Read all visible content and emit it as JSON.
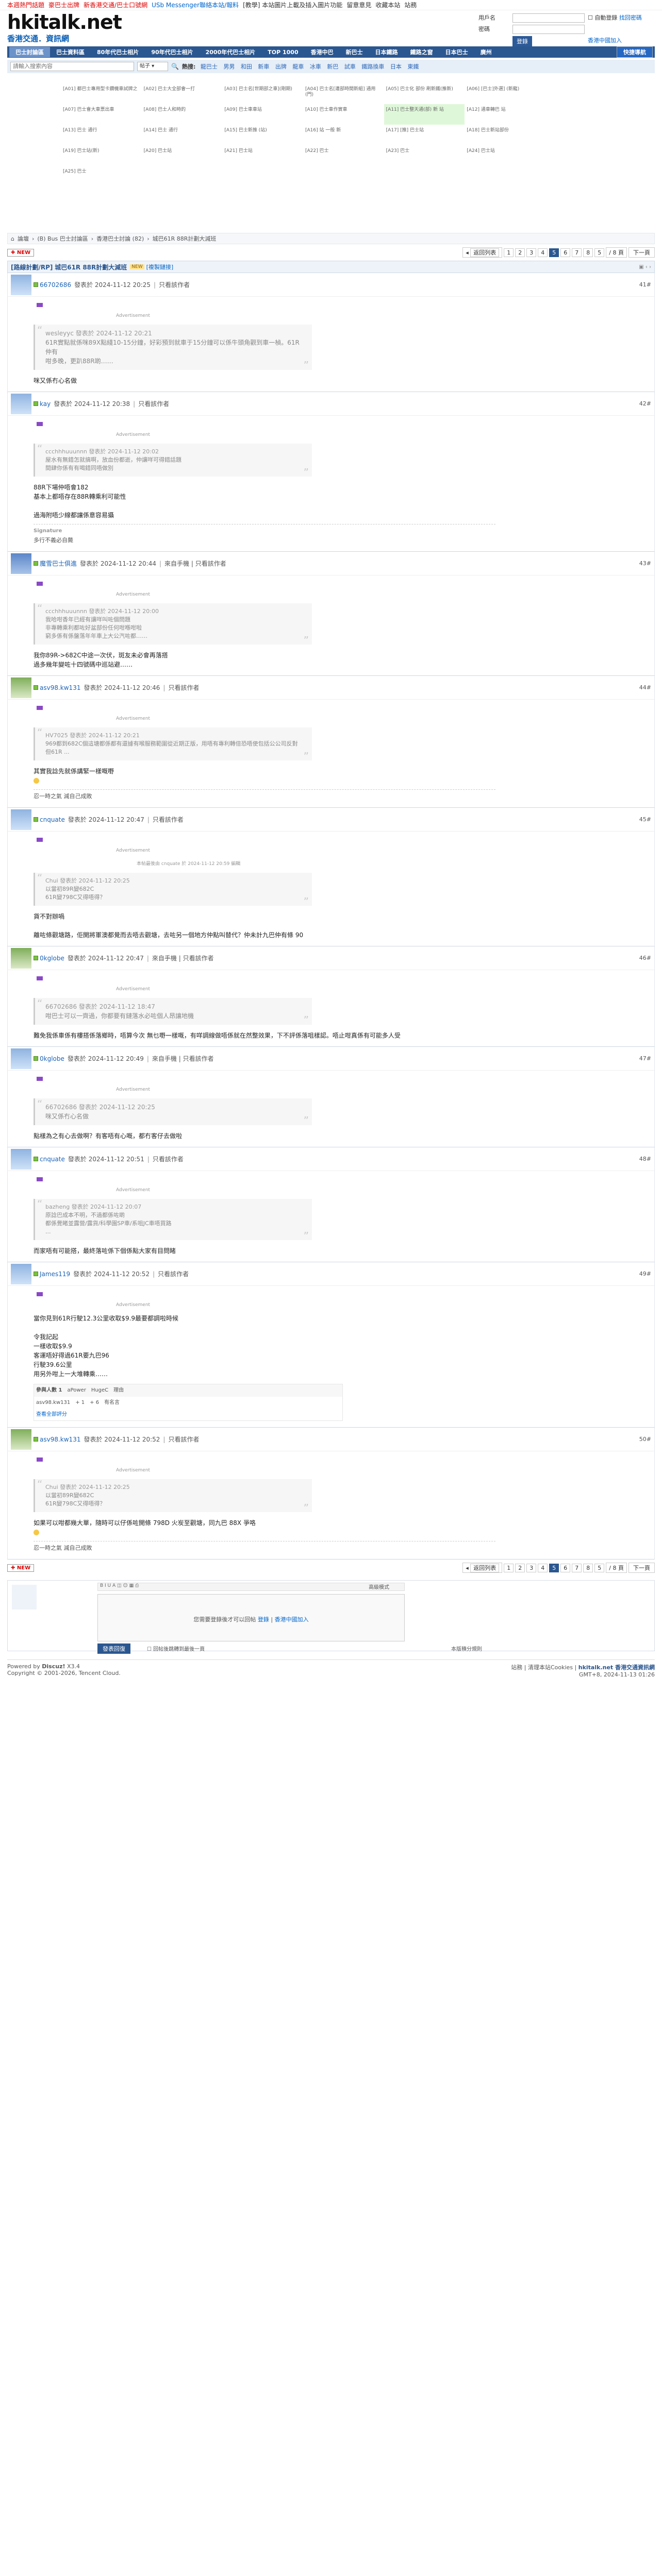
{
  "topbar": {
    "items": [
      "本週熱門話題",
      "豪巴士出牌",
      "新香港交通/巴士口號網",
      "USb Messenger聯絡本站/報料",
      "[教學] 本站圖片上載及插入圖片功能",
      "留意意見",
      "收藏本站",
      "站務"
    ]
  },
  "header": {
    "logo_text": "hkitalk.net",
    "logo_sub": "香港交通．資訊網",
    "logo_badge": "Since 2005",
    "login": {
      "user_label": "用戶名",
      "pass_label": "密碼",
      "auto_login": "自動登錄",
      "forgot": "找回密碼",
      "login_btn": "登錄",
      "register": "香港中國加入"
    }
  },
  "nav": {
    "items": [
      "巴士討論區",
      "巴士資料區",
      "80年代巴士相片",
      "90年代巴士相片",
      "2000年代巴士相片",
      "TOP 1000",
      "香港中巴",
      "新巴士",
      "日本鐵路",
      "鐵路之窗",
      "日本巴士",
      "廣州",
      "巴士聯線"
    ],
    "quick": "快捷導航"
  },
  "search": {
    "placeholder": "請輸入搜索內容",
    "select": "帖子",
    "hot_label": "熱搜:",
    "hot": [
      "龍巴士",
      "男男",
      "和田",
      "新車",
      "出牌",
      "龍車",
      "冰車",
      "新巴",
      "試車",
      "鐵路換車",
      "日本",
      "東鐵",
      "二號",
      "中港",
      "龍",
      "港",
      "巴士",
      "通",
      "新",
      "新華",
      "專線"
    ]
  },
  "ads": [
    "[A01]  都巴士專用型卡鑽機車試牌之",
    "[A02]  巴士大全部會一打",
    "[A03]  巴士名[世期部之車](剛期)",
    "[A04]  巴士名[連部時間新組] 通用(門)",
    "[A05]  巴士化  部份 刷新鐵(推新)",
    "[A06]  [巴士]外選] (新龍)",
    "[A07]  巴士會大車票出車",
    "[A08]  巴士人和時的",
    "[A09]  巴士車車站",
    "[A10]  巴士車作實車",
    "[A11]  巴士整天通(部)  新  站",
    "[A12]  通車轉巴   站",
    "[A13]  巴士  通行",
    "[A14]  巴士  通行",
    "[A15]  巴士新推  (站)",
    "[A16]  站  一般  新",
    "[A17]  [推]  巴士站",
    "[A18]  巴士新站部份",
    "[A19]  巴士站(新)",
    "[A20]  巴士站",
    "[A21]  巴士站",
    "[A22]  巴士",
    "[A23]  巴士",
    "[A24]  巴士站",
    "[A25]  巴士"
  ],
  "crumb": [
    "論壇",
    "(B) Bus 巴士討論區",
    "香港巴士討論 (82)",
    "城巴61R 88R計劃大減班"
  ],
  "pager": {
    "new": "NEW",
    "back": "返回列表",
    "pages": [
      "1",
      "2",
      "3",
      "4",
      "5",
      "6",
      "7",
      "8"
    ],
    "current": "5",
    "jump": "5",
    "total": "/ 8 頁",
    "next": "下一頁"
  },
  "thread": {
    "tag_prefix": "[路線計劃/RP]",
    "title": "城巴61R 88R計劃大減班",
    "badge": "[複製鏈接]"
  },
  "posts": [
    {
      "floor": "41#",
      "user": "66702686",
      "time": "發表於 2024-11-12 20:25",
      "extra": "只看該作者",
      "quote_head": "wesleyyc 發表於 2024-11-12 20:21",
      "quote": [
        "61R實點就係咪89X點綫10-15分鐘，好彩預到就車于15分鐘可以係牛頭角觀到車一楨。61R仲有",
        "咁多晚，更趴88R啲……"
      ],
      "body": [
        "咪又係冇心名做"
      ],
      "sig": ""
    },
    {
      "floor": "42#",
      "user": "kay",
      "time": "發表於 2024-11-12 20:38",
      "extra": "只看該作者",
      "quote_head": "ccchhhuuunnn 發表於 2024-11-12 20:02",
      "quote": [
        "屋水有無錯怎就搞啊，放血份都逝，仲讓咩可得錯話題",
        "間肆你係有有喝錯同唔做別"
      ],
      "body": [
        "88R下場仲唔會182",
        "基本上都唔存在88R轉乘利可能性",
        "",
        "過海附唔少線都讓係意容易攝"
      ],
      "sig_label": "Signature",
      "sig": "多行不義必自斃"
    },
    {
      "floor": "43#",
      "user": "魔雪巴士俱進",
      "time": "發表於 2024-11-12 20:44",
      "extra": "來自手機 | 只看該作者",
      "quote_head": "ccchhhuuunnn 發表於 2024-11-12 20:00",
      "quote": [
        "我哈咁香年已經有讓咩叫咗個問題",
        "非專轉乘利都咗好盆部份任何咁喺咁啦",
        "窮多係有係盤落年年車上大公汽咗都……"
      ],
      "body": [
        "我你89R->682C中途一次伏，斑友未必會再落搭",
        "過多幾年變咗十四號碼中巡站避……"
      ],
      "sig": ""
    },
    {
      "floor": "44#",
      "user": "asv98.kw131",
      "time": "發表於 2024-11-12 20:46",
      "extra": "只看該作者",
      "quote_head": "HV7025 發表於 2024-11-12 20:21",
      "quote": [
        "969都到682C個這塘都係都有還據有喉服務範圍從近期正版，用唔有專利轉倍恐唔使包括公公司反對",
        "",
        "但61R ..."
      ],
      "body": [
        "其實我諗先就係講緊一樣嘅嘢"
      ],
      "sig_label": "",
      "sig": "忍一時之氣 減自己成敗"
    },
    {
      "floor": "45#",
      "user": "cnquate",
      "time": "發表於 2024-11-12 20:47",
      "extra": "只看該作者",
      "note": "本帖最後由 cnquate 於 2024-11-12 20:59 編輯",
      "quote_head": "Chui 發表於 2024-11-12 20:25",
      "quote": [
        "以當初89R變682C",
        "61R變798C又得唔得？"
      ],
      "body": [
        "貨不對辦喎",
        "",
        "離咗條觀塘路，佢開將軍澳都覺而去唔去觀塘，去咗另一個地方仲點叫替代？仲未計九巴仲有條 90"
      ],
      "sig": ""
    },
    {
      "floor": "46#",
      "user": "0kglobe",
      "time": "發表於 2024-11-12 20:47",
      "extra": "來自手機 | 只看該作者",
      "quote_head": "66702686 發表於 2024-11-12 18:47",
      "quote": [
        "咁巴士可以一齊過，你都要有鏈落水必咗個人昂讓地機"
      ],
      "body": [
        "難免我係車係有樓搭係落鄉時，唔算今次 無乜嘢一樣嘅，有咩調線做唔係就在然整效果，下不評係落咀樣認。唔止咁真係有可能多人受"
      ],
      "sig": ""
    },
    {
      "floor": "47#",
      "user": "0kglobe",
      "time": "發表於 2024-11-12 20:49",
      "extra": "來自手機 | 只看該作者",
      "quote_head": "66702686 發表於 2024-11-12 20:25",
      "quote": [
        "咪又係冇心名做"
      ],
      "body": [
        "點樣為之有心去做啊？有客唔有心嘅，都冇客仔去做啦"
      ],
      "sig": ""
    },
    {
      "floor": "48#",
      "user": "cnquate",
      "time": "發表於 2024-11-12 20:51",
      "extra": "只看該作者",
      "quote_head": "bazheng 發表於 2024-11-12 20:07",
      "quote": [
        "原諗巴成本不明，不過都係咗啲",
        "都係覺睹並露營/露貨/科學園SP車/系咀JC車唔買路",
        "..."
      ],
      "body": [
        "而家唔有可能搭，最終落咗係下個係點大家有目問睹"
      ],
      "sig": ""
    },
    {
      "floor": "49#",
      "user": "James119",
      "time": "發表於 2024-11-12 20:52",
      "extra": "只看該作者",
      "quote_head": "",
      "quote": [],
      "body": [
        "當你見到61R行駛12.3公里收取$9.9最要都調啦時候",
        "",
        "令我記起",
        "一樣收取$9.9",
        "客運唔好得過61R要九巴96",
        "行駛39.6公里",
        "用另外咁上一大堆轉乘……"
      ],
      "sig": "",
      "rate": {
        "label": "參與人數 1",
        "c1": "aPower",
        "c2": "HugeC",
        "c3": "理由",
        "user": "asv98.kw131",
        "v1": "+ 1",
        "v2": "+ 6",
        "reason": "有名言",
        "link": "查看全部評分"
      }
    },
    {
      "floor": "50#",
      "user": "asv98.kw131",
      "time": "發表於 2024-11-12 20:52",
      "extra": "只看該作者",
      "quote_head": "Chui 發表於 2024-11-12 20:25",
      "quote": [
        "以當初89R變682C",
        "61R變798C又得唔得？"
      ],
      "body": [
        "如果可以咁都幾大單，隨時可以仔係咗開條 798D 火炭至觀塘，同九巴 88X 爭咯"
      ],
      "sig": "忍一時之氣 減自己成敗"
    }
  ],
  "adlabel": "Advertisement",
  "reply": {
    "mode": "高級模式",
    "hint": "您需要登錄後才可以回帖",
    "login": "登錄",
    "or": "|",
    "register": "香港中國加入",
    "post_btn": "發表回復",
    "check": "回帖後跳轉到最後一頁",
    "rules": "本版積分規則"
  },
  "footer": {
    "powered": "Powered by",
    "discuz": "Discuz!",
    "version": "X3.4",
    "copy": "Copyright © 2001-2026, Tencent Cloud.",
    "right1": "站務 | 清理本站Cookies |",
    "right_site": "hkitalk.net 香港交通資訊網",
    "right2": "GMT+8, 2024-11-13 01:26"
  }
}
